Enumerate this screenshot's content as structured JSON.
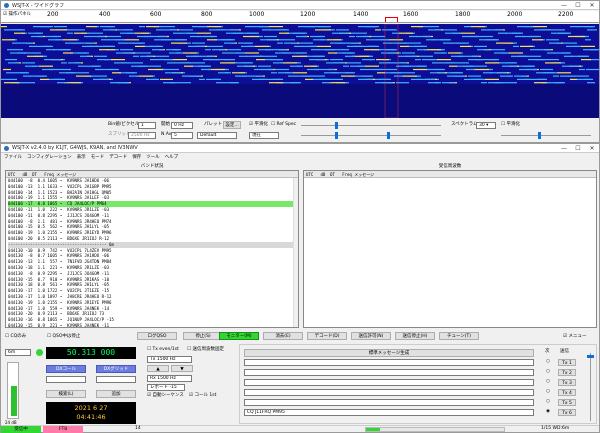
{
  "wide": {
    "title": "WSJT-X - ワイドグラフ",
    "ctrl_min": "—",
    "ctrl_max": "☐",
    "ctrl_close": "✕",
    "tick_left": "1-2 3 4",
    "control_chk": "操作パネル",
    "tick_labels": [
      "200",
      "400",
      "600",
      "800",
      "1000",
      "1200",
      "1400",
      "1600",
      "1800",
      "2000",
      "2200"
    ],
    "bins_label": "Bin値/ピクセル",
    "bins_value": "1",
    "start_label": "開始",
    "start_value": "0 Hz",
    "palette_label": "パレット",
    "settings_btn": "設定...",
    "flatten_label": "平滑化",
    "ref_spec_label": "Ref Spec",
    "spectrum_label": "スペクトラム",
    "spectrum_value": "30 ▾",
    "split_label": "スプリット",
    "split_value": "2500 Hz",
    "avg_label": "N Avg",
    "avg_value": "5",
    "default_value": "Default",
    "current_value": "現在",
    "flatten2_label": "平滑化"
  },
  "main": {
    "title": "WSJT-X   v2.4.0   by K1JT, G4WJS, K9AN, and IV3NWV",
    "ctrl_min": "—",
    "ctrl_max": "☐",
    "ctrl_close": "✕",
    "menu": [
      "ファイル",
      "コンフィグレーション",
      "表示",
      "モード",
      "デコード",
      "保存",
      "ツール",
      "ヘルプ"
    ],
    "band_title": "バンド状況",
    "rx_title": "受信周波数",
    "col_headers": [
      "UTC",
      "dB",
      "DT",
      "Freq",
      "メッセージ"
    ],
    "band_rows": [
      "044100  -8  0.4 1605 ~  KV9NRS JA1HDO -06",
      "044100 -13  1.1 1633 ~  VU2CPL JA1GBP PM95",
      "044100 -14  1.1 1523 ~  BH2AIN JA1HGL QM05",
      "044100 -19  1.1 1555 ~  KV9NRS JA1LEF -03",
      "044100 -17  0.8 1065 ~  CQ JA4LOC/P PM64",
      "044100 -11  1.0  222 ~  KV9NRS JR1LZE -03",
      "044100 -11  0.8 2295 ~  JJ1JCS JO4GOM -11",
      "044100  -8  1.1  481 ~  KV9NRS JR4HEU PM74",
      "044100 -15  0.5  562 ~  KV9NRS JH1LYL -05",
      "044100 -19  1.0 2155 ~  KV9NRS JR1EYD PM96",
      "044100 -20  0.5 2113 ~  BD6XE JR1IOJ R-12",
      "---------------------------------------- 6m",
      "044130 -10  0.9  742 ~  VU2CPL 7L4ZEV PM95",
      "044130  -8  0.7 1605 ~  KV9NRS JA1HDO -06",
      "044130 -13  1.1  557 ~  7N1FVD JG4TDN PM84",
      "044130 -18  1.1  221 ~  KV9NRS JR1LZE -03",
      "044130  -8  0.9 2295 ~  JJ1JCS JO4GOM -11",
      "044130 -15  0.7  910 ~  KV9NRS JR1KAS -10",
      "044130 -18  0.8  561 ~  KV9NRS JH1LYL -05",
      "044130 -17  1.0 1722 ~  VU2CPL JT1EZE -15",
      "044130 -17  1.0 1897 ~  JH8CRE JR4HEU R-12",
      "044130 -19  1.0 2155 ~  KV9NRS JR1EYE PM96",
      "044130 -17  1.0  559 ~  KV9NRS JA4NEK -14",
      "044130 -20  0.9 2113 ~  BD6XE JR1IOJ 73",
      "044130 -16  0.8 1065 ~  JQ1NUP JA4LOC/P -15",
      "044130 -15  0.9  221 ~  KV9NRS JA4NEK -11"
    ],
    "cq_only": "CQのみ",
    "lock_tx": "QSO中は停止",
    "log_btn": "ログQSO",
    "stop_btn": "停止(S)",
    "monitor_btn": "モニター(M)",
    "erase_btn": "消去(E)",
    "decode_btn": "デコード(D)",
    "enable_tx_btn": "送信許可(N)",
    "halt_tx_btn": "送信停止(H)",
    "tune_btn": "チューン(T)",
    "menus_chk": "メニュー",
    "band_value": "6m",
    "freq_value": "50.313 000",
    "dx_call_label": "DXコール",
    "dx_grid_label": "DXグリッド",
    "lookup_btn": "検索(L)",
    "add_btn": "追加",
    "date_value": "2021 6 27",
    "time_value": "04:41:46",
    "db_label": "24 dB",
    "hold_tx": "Tx even/1st",
    "hold_tx2": "送信周波数固定",
    "tx_hz": "Tx  1500 Hz",
    "rx_hz": "Rx  1500 Hz",
    "report": "レポート -15",
    "auto_seq": "自動シーケンス",
    "call_1st": "コール 1st",
    "gen_std_btn": "標準メッセージ生成",
    "next_label": "次",
    "now_label": "送信",
    "tx_buttons": [
      "Tx 1",
      "Tx 2",
      "Tx 3",
      "Tx 4",
      "Tx 5",
      "Tx 6"
    ],
    "tx6_value": "CQ JL1FRQ PM95",
    "status_rx": "受信中",
    "status_mode": "FT8",
    "status_last": "14",
    "status_right": "1/15  WD:6m"
  }
}
